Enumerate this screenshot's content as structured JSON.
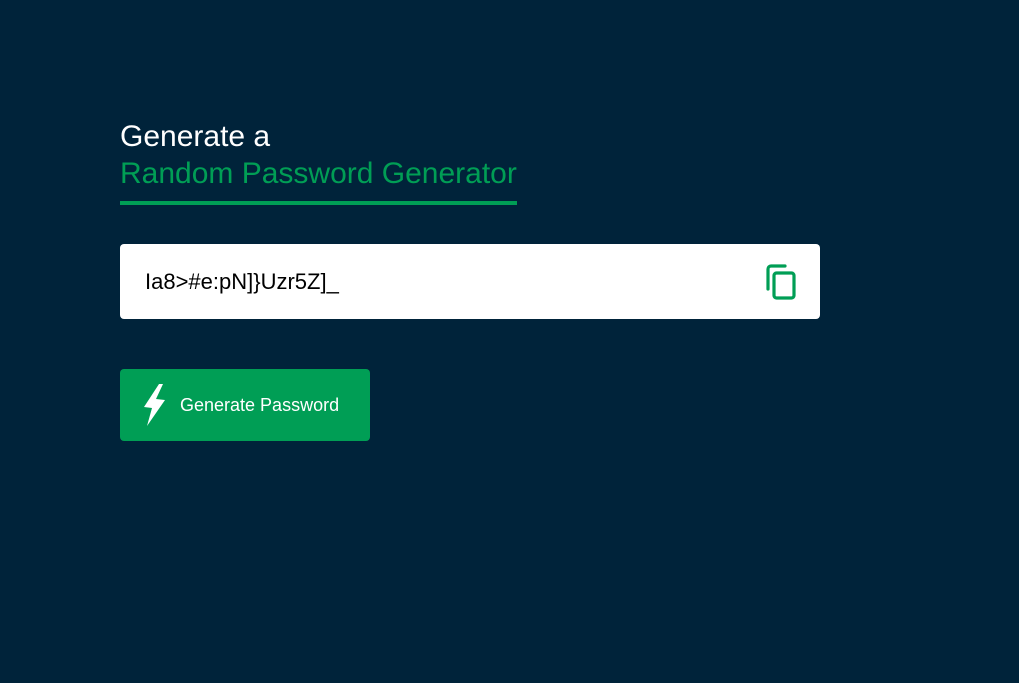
{
  "header": {
    "line1": "Generate a",
    "line2": "Random Password Generator"
  },
  "password": {
    "value": "Ia8>#e:pN]}Uzr5Z]_"
  },
  "generate_button": {
    "label": "Generate Password"
  },
  "colors": {
    "background": "#00233a",
    "accent": "#009e55",
    "text_light": "#ffffff",
    "input_bg": "#ffffff"
  },
  "icons": {
    "copy": "copy-icon",
    "generate": "lightning-bolt-icon"
  }
}
